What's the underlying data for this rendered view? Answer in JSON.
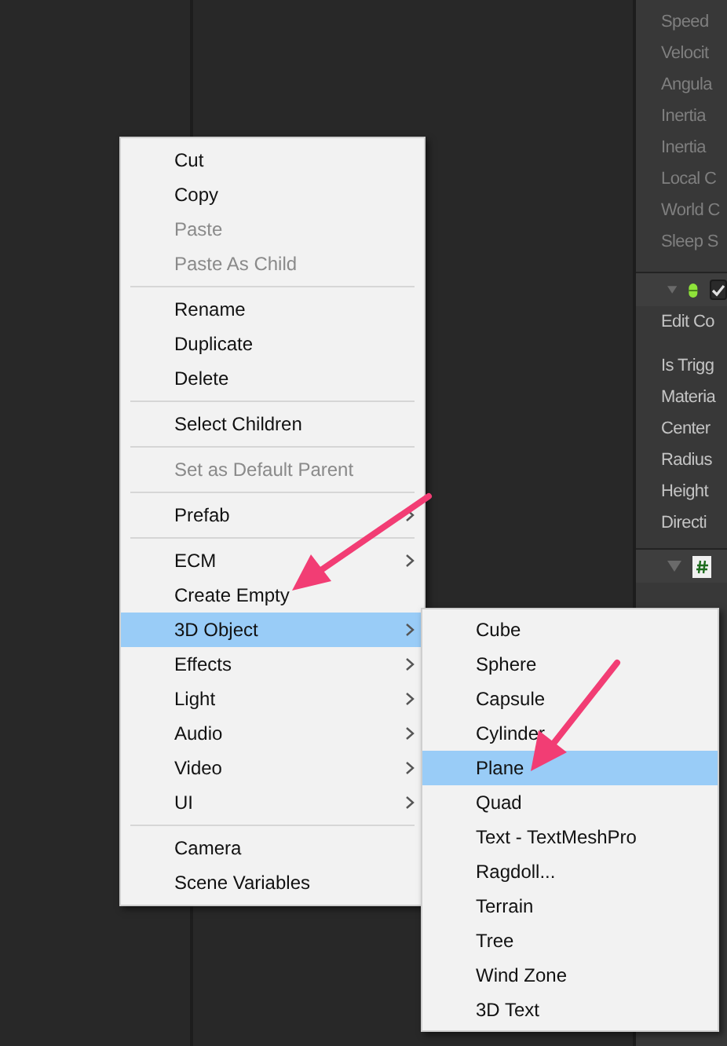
{
  "inspector": {
    "readonly_fields": [
      "Speed",
      "Velocit",
      "Angula",
      "Inertia",
      "Inertia",
      "Local C",
      "World C",
      "Sleep S"
    ],
    "components": [
      {
        "kind": "capsule",
        "enabled": true,
        "fields": [
          "Edit Co",
          "Is Trigg",
          "Materia",
          "Center",
          "Radius",
          "Height",
          "Directi"
        ]
      },
      {
        "kind": "script"
      }
    ]
  },
  "context_menu": {
    "items": [
      {
        "kind": "item",
        "label": "Cut",
        "disabled": false,
        "submenu": false,
        "selected": false
      },
      {
        "kind": "item",
        "label": "Copy",
        "disabled": false,
        "submenu": false,
        "selected": false
      },
      {
        "kind": "item",
        "label": "Paste",
        "disabled": true,
        "submenu": false,
        "selected": false
      },
      {
        "kind": "item",
        "label": "Paste As Child",
        "disabled": true,
        "submenu": false,
        "selected": false
      },
      {
        "kind": "separator"
      },
      {
        "kind": "item",
        "label": "Rename",
        "disabled": false,
        "submenu": false,
        "selected": false
      },
      {
        "kind": "item",
        "label": "Duplicate",
        "disabled": false,
        "submenu": false,
        "selected": false
      },
      {
        "kind": "item",
        "label": "Delete",
        "disabled": false,
        "submenu": false,
        "selected": false
      },
      {
        "kind": "separator"
      },
      {
        "kind": "item",
        "label": "Select Children",
        "disabled": false,
        "submenu": false,
        "selected": false
      },
      {
        "kind": "separator"
      },
      {
        "kind": "item",
        "label": "Set as Default Parent",
        "disabled": true,
        "submenu": false,
        "selected": false
      },
      {
        "kind": "separator"
      },
      {
        "kind": "item",
        "label": "Prefab",
        "disabled": false,
        "submenu": true,
        "selected": false
      },
      {
        "kind": "separator"
      },
      {
        "kind": "item",
        "label": "ECM",
        "disabled": false,
        "submenu": true,
        "selected": false
      },
      {
        "kind": "item",
        "label": "Create Empty",
        "disabled": false,
        "submenu": false,
        "selected": false
      },
      {
        "kind": "item",
        "label": "3D Object",
        "disabled": false,
        "submenu": true,
        "selected": true
      },
      {
        "kind": "item",
        "label": "Effects",
        "disabled": false,
        "submenu": true,
        "selected": false
      },
      {
        "kind": "item",
        "label": "Light",
        "disabled": false,
        "submenu": true,
        "selected": false
      },
      {
        "kind": "item",
        "label": "Audio",
        "disabled": false,
        "submenu": true,
        "selected": false
      },
      {
        "kind": "item",
        "label": "Video",
        "disabled": false,
        "submenu": true,
        "selected": false
      },
      {
        "kind": "item",
        "label": "UI",
        "disabled": false,
        "submenu": true,
        "selected": false
      },
      {
        "kind": "separator"
      },
      {
        "kind": "item",
        "label": "Camera",
        "disabled": false,
        "submenu": false,
        "selected": false
      },
      {
        "kind": "item",
        "label": "Scene Variables",
        "disabled": false,
        "submenu": false,
        "selected": false
      }
    ]
  },
  "submenu": {
    "items": [
      {
        "label": "Cube",
        "selected": false
      },
      {
        "label": "Sphere",
        "selected": false
      },
      {
        "label": "Capsule",
        "selected": false
      },
      {
        "label": "Cylinder",
        "selected": false
      },
      {
        "label": "Plane",
        "selected": true
      },
      {
        "label": "Quad",
        "selected": false
      },
      {
        "label": "Text - TextMeshPro",
        "selected": false
      },
      {
        "label": "Ragdoll...",
        "selected": false
      },
      {
        "label": "Terrain",
        "selected": false
      },
      {
        "label": "Tree",
        "selected": false
      },
      {
        "label": "Wind Zone",
        "selected": false
      },
      {
        "label": "3D Text",
        "selected": false
      }
    ]
  }
}
